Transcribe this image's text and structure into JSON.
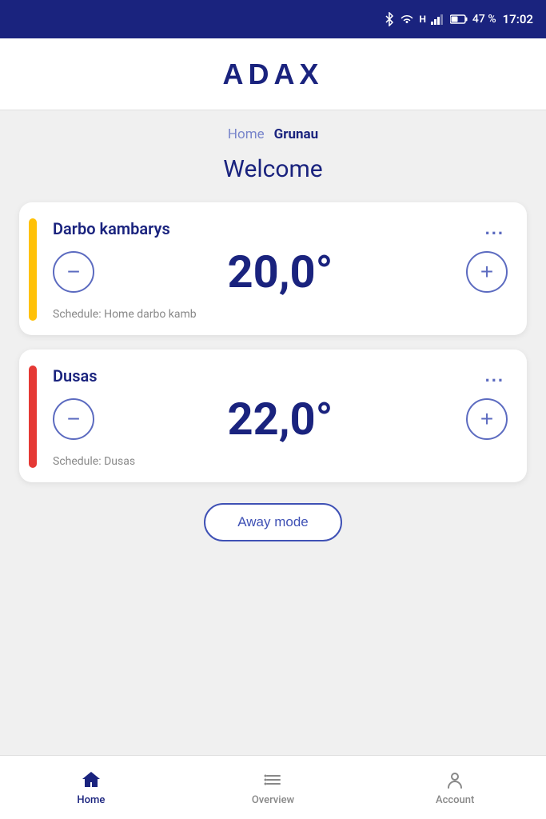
{
  "status_bar": {
    "battery": "47 %",
    "time": "17:02",
    "icons": [
      "bluetooth",
      "wifi",
      "signal",
      "battery"
    ]
  },
  "header": {
    "logo": "ADAX"
  },
  "breadcrumb": {
    "home_label": "Home",
    "current_label": "Grunau"
  },
  "welcome": {
    "title": "Welcome"
  },
  "devices": [
    {
      "id": "darbo",
      "name": "Darbo kambarys",
      "temperature": "20,0°",
      "schedule": "Schedule: Home darbo kamb",
      "indicator_color": "indicator-yellow",
      "more_label": "..."
    },
    {
      "id": "dusas",
      "name": "Dusas",
      "temperature": "22,0°",
      "schedule": "Schedule: Dusas",
      "indicator_color": "indicator-orange",
      "more_label": "..."
    }
  ],
  "away_mode_button": {
    "label": "Away mode"
  },
  "bottom_nav": {
    "items": [
      {
        "id": "home",
        "label": "Home",
        "active": true
      },
      {
        "id": "overview",
        "label": "Overview",
        "active": false
      },
      {
        "id": "account",
        "label": "Account",
        "active": false
      }
    ]
  },
  "controls": {
    "minus_label": "−",
    "plus_label": "+"
  }
}
